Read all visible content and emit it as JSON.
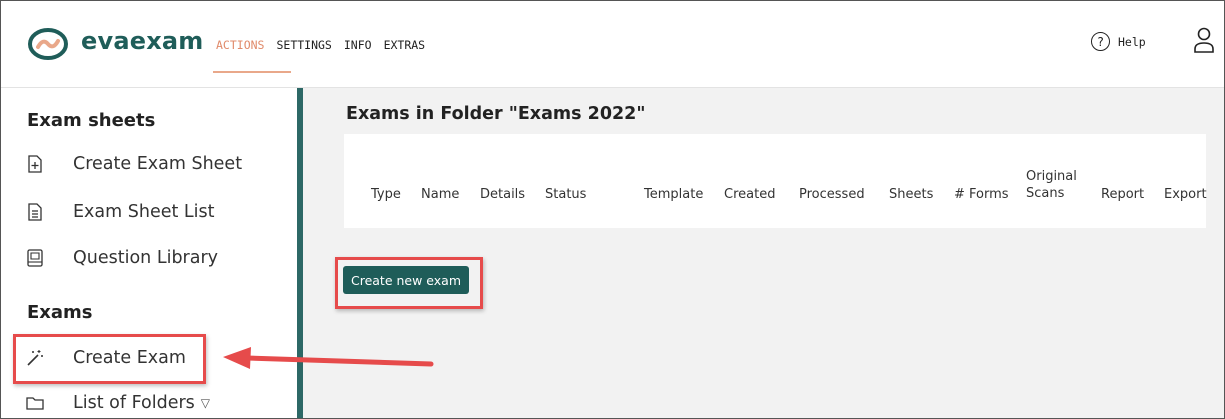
{
  "app": {
    "brand": "evaexam"
  },
  "nav": {
    "items": [
      "ACTIONS",
      "SETTINGS",
      "INFO",
      "EXTRAS"
    ]
  },
  "header": {
    "help_label": "Help"
  },
  "sidebar": {
    "sections": [
      {
        "title": "Exam sheets",
        "items": [
          "Create Exam Sheet",
          "Exam Sheet List",
          "Question Library"
        ]
      },
      {
        "title": "Exams",
        "items": [
          "Create Exam",
          "List of Folders"
        ]
      }
    ]
  },
  "main": {
    "title": "Exams in Folder \"Exams 2022\"",
    "table": {
      "columns": [
        "Type",
        "Name",
        "Details",
        "Status",
        "Template",
        "Created",
        "Processed",
        "Sheets",
        "# Forms",
        "Original Scans",
        "Report",
        "Export"
      ],
      "rows": []
    },
    "create_button": "Create new exam"
  },
  "colors": {
    "brand": "#1f5d59",
    "active_nav": "#e08a6a",
    "highlight": "#e64b4b"
  },
  "icons": [
    "evaexam-logo-icon",
    "help-circle-icon",
    "user-icon",
    "file-plus-icon",
    "file-list-icon",
    "book-icon",
    "magic-wand-icon",
    "folder-icon",
    "dropdown-triangle-icon",
    "arrow-icon"
  ]
}
